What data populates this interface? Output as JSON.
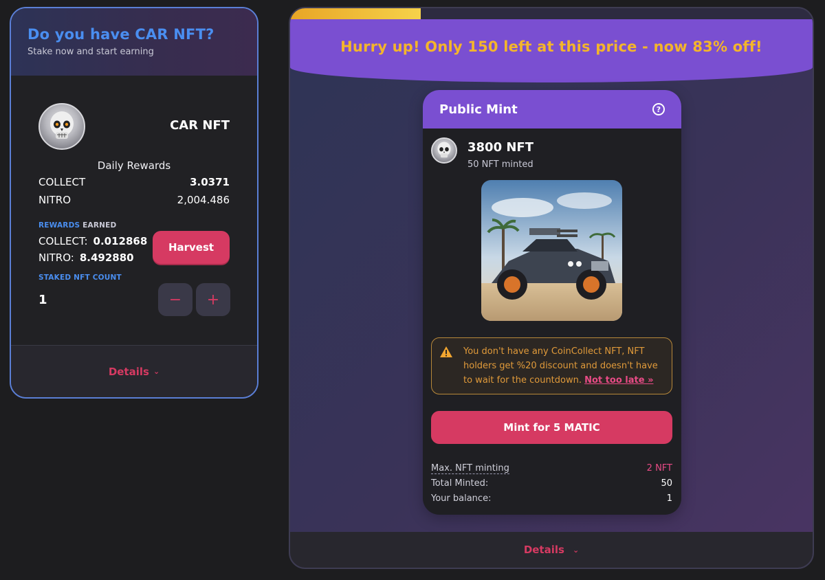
{
  "stake": {
    "title": "Do you have CAR NFT?",
    "subtitle": "Stake now and start earning",
    "nft_name": "CAR NFT",
    "daily_rewards_label": "Daily Rewards",
    "daily_rewards": [
      {
        "token": "COLLECT",
        "value": "3.0371"
      },
      {
        "token": "NITRO",
        "value": "2,004.486"
      }
    ],
    "rewards_label_1": "REWARDS",
    "rewards_label_2": "EARNED",
    "earned": [
      {
        "token": "COLLECT:",
        "value": "0.012868"
      },
      {
        "token": "NITRO:",
        "value": "8.492880"
      }
    ],
    "harvest_label": "Harvest",
    "staked_count_label": "STAKED NFT COUNT",
    "staked_count": "1",
    "minus_label": "−",
    "plus_label": "+",
    "details_label": "Details"
  },
  "mint": {
    "banner": "Hurry up! Only 150 left at this price - now 83% off!",
    "progress_fraction": 0.25,
    "progress_colors": [
      "#e8a526",
      "#f6d24a"
    ],
    "card_title": "Public Mint",
    "help_icon": "question-circle-icon",
    "supply": "3800 NFT",
    "minted_text": "50 NFT minted",
    "warning_text": "You don't have any CoinCollect NFT, NFT holders get %20 discount and doesn't have to wait for the countdown.",
    "warning_link": "Not too late »",
    "mint_button": "Mint for 5 MATIC",
    "info": [
      {
        "label": "Max. NFT minting",
        "value": "2 NFT"
      },
      {
        "label": "Total Minted:",
        "value": "50"
      },
      {
        "label": "Your balance:",
        "value": "1"
      }
    ],
    "details_label": "Details"
  },
  "colors": {
    "accent_pink": "#d63a62",
    "accent_purple": "#7a4fd1",
    "accent_blue": "#4a8ef0",
    "banner_text": "#f4b52b",
    "warning": "#e09a3a"
  }
}
